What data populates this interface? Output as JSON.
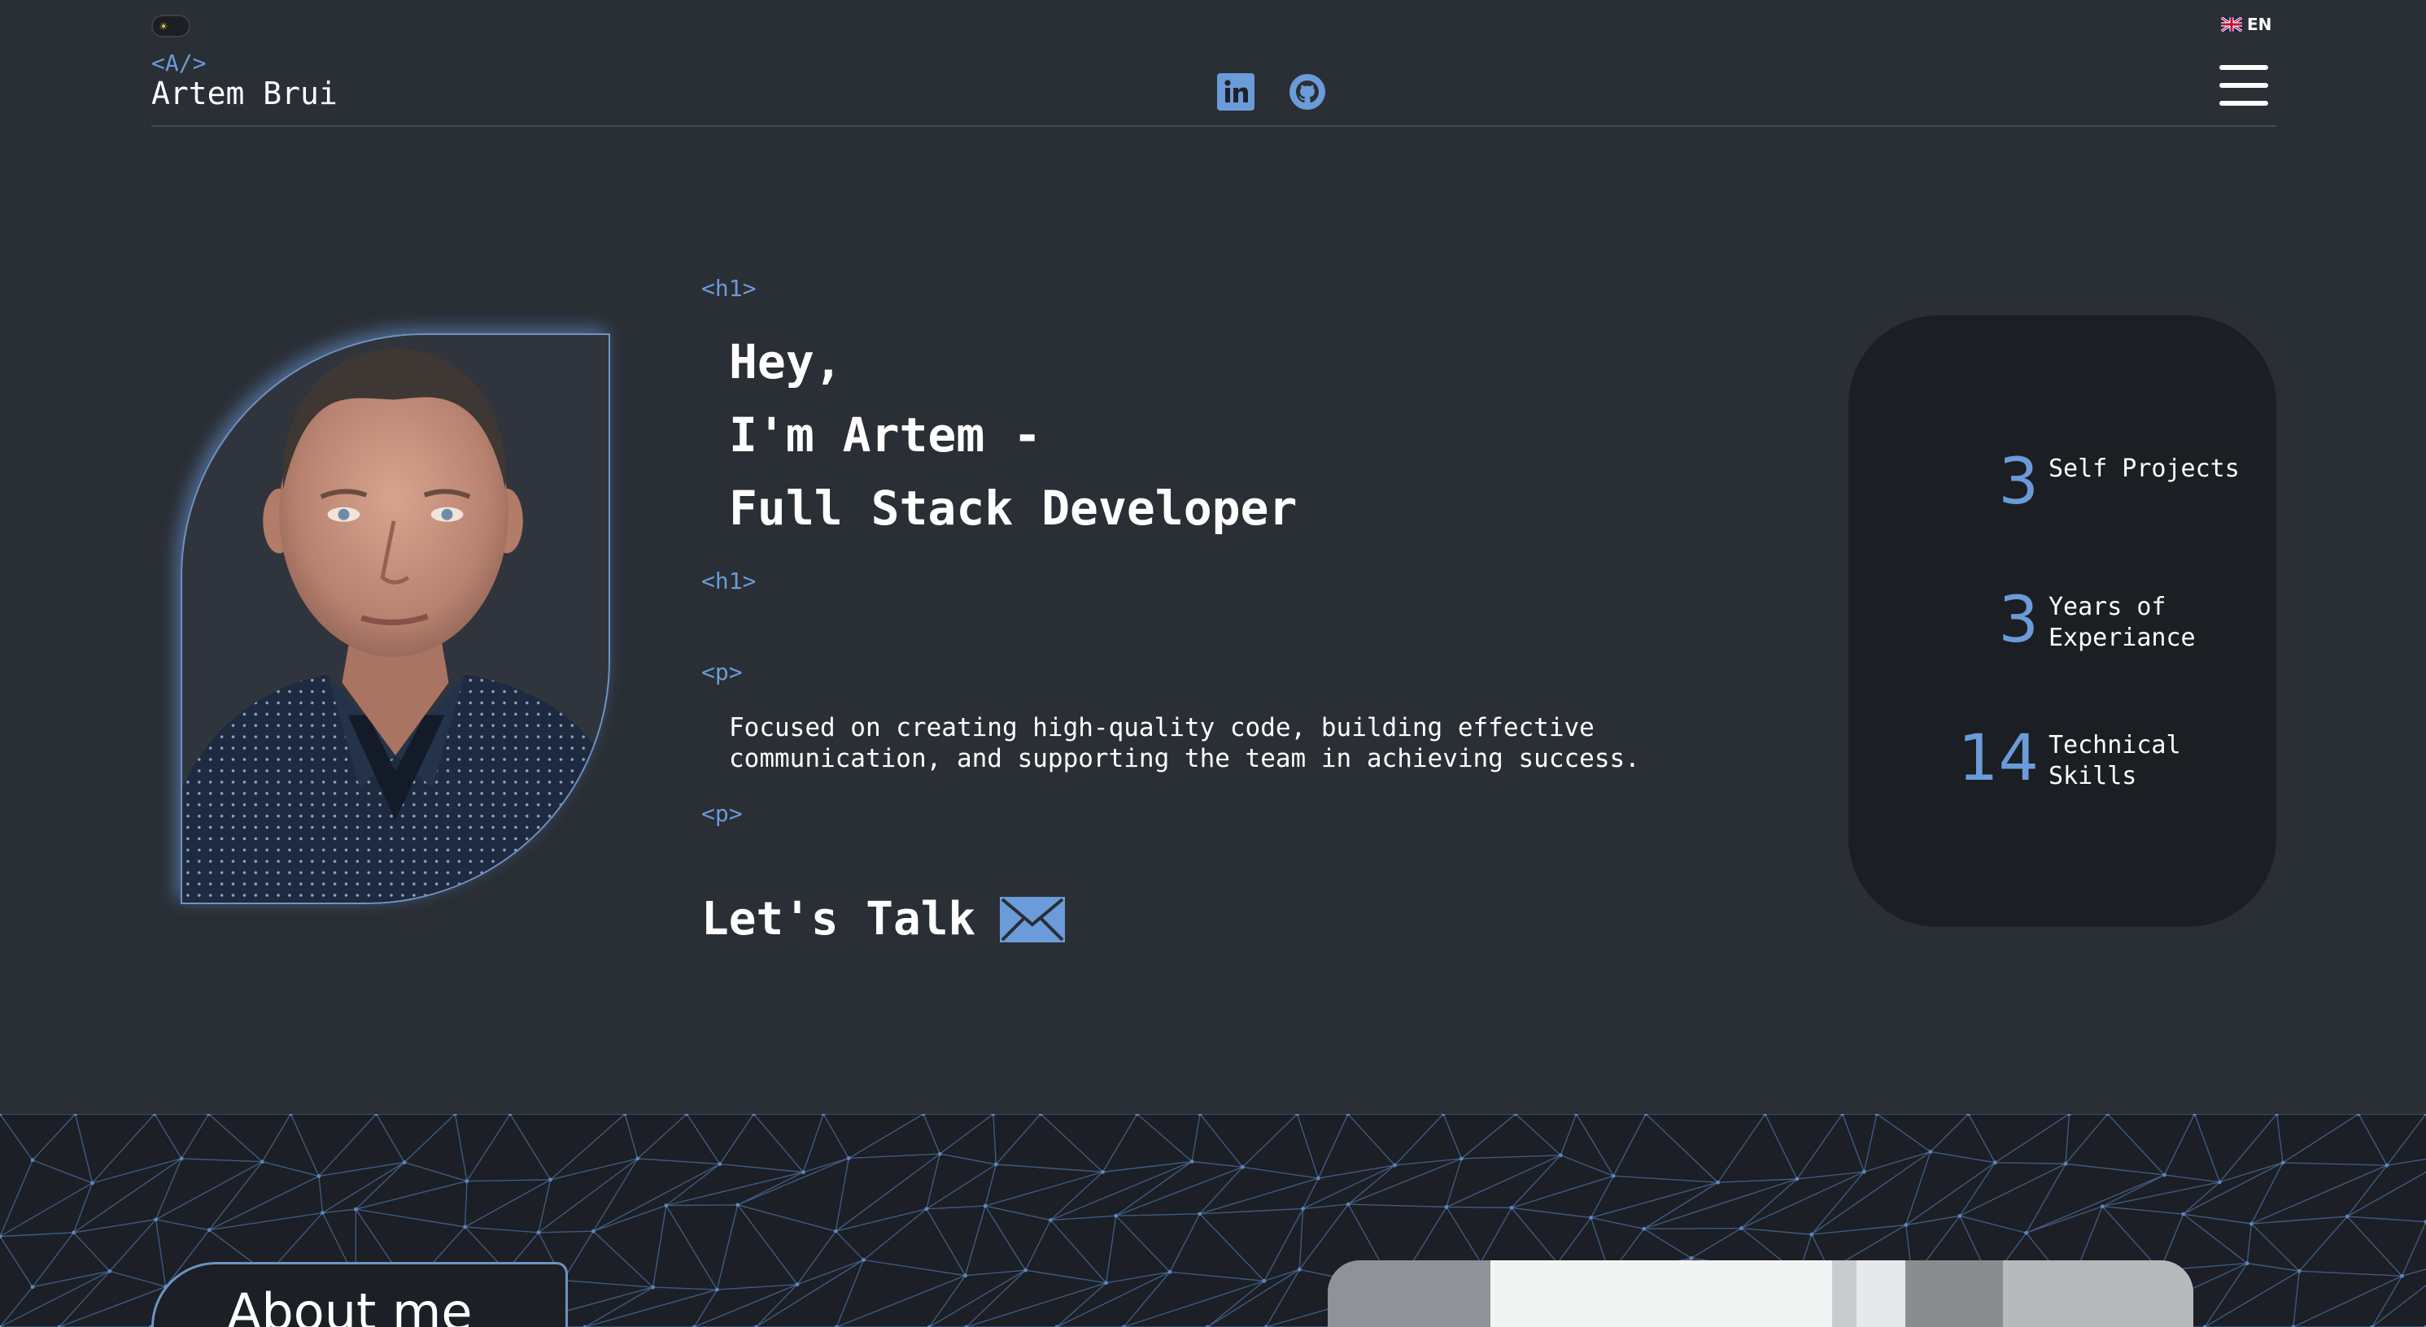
{
  "header": {
    "theme_toggle_icon": "sun-icon",
    "language": {
      "flag_icon": "uk-flag-icon",
      "label": "EN"
    },
    "logo": {
      "tag": "<A/>",
      "name": "Artem Brui"
    },
    "socials": [
      {
        "name": "linkedin-icon",
        "color": "#6b9bd8"
      },
      {
        "name": "github-icon",
        "color": "#6b9bd8"
      }
    ],
    "menu_icon": "hamburger-menu-icon"
  },
  "hero": {
    "h1_open_tag": "<h1>",
    "title_lines": [
      "Hey,",
      "I'm Artem -",
      "Full Stack Developer"
    ],
    "h1_close_tag": "<h1>",
    "p_open_tag": "<p>",
    "description": "Focused on creating high-quality code, building effective communication, and supporting the team in achieving success.",
    "p_close_tag": "<p>",
    "cta_label": "Let's Talk",
    "cta_icon": "mail-icon"
  },
  "stats": [
    {
      "value": "3",
      "label": "Self Projects"
    },
    {
      "value": "3",
      "label": "Years of Experiance"
    },
    {
      "value": "14",
      "label": "Technical Skills"
    }
  ],
  "about": {
    "heading": "About me"
  },
  "colors": {
    "background": "#2a2e35",
    "accent": "#6b9bd8",
    "card": "#1b1e23",
    "text": "#ffffff"
  }
}
